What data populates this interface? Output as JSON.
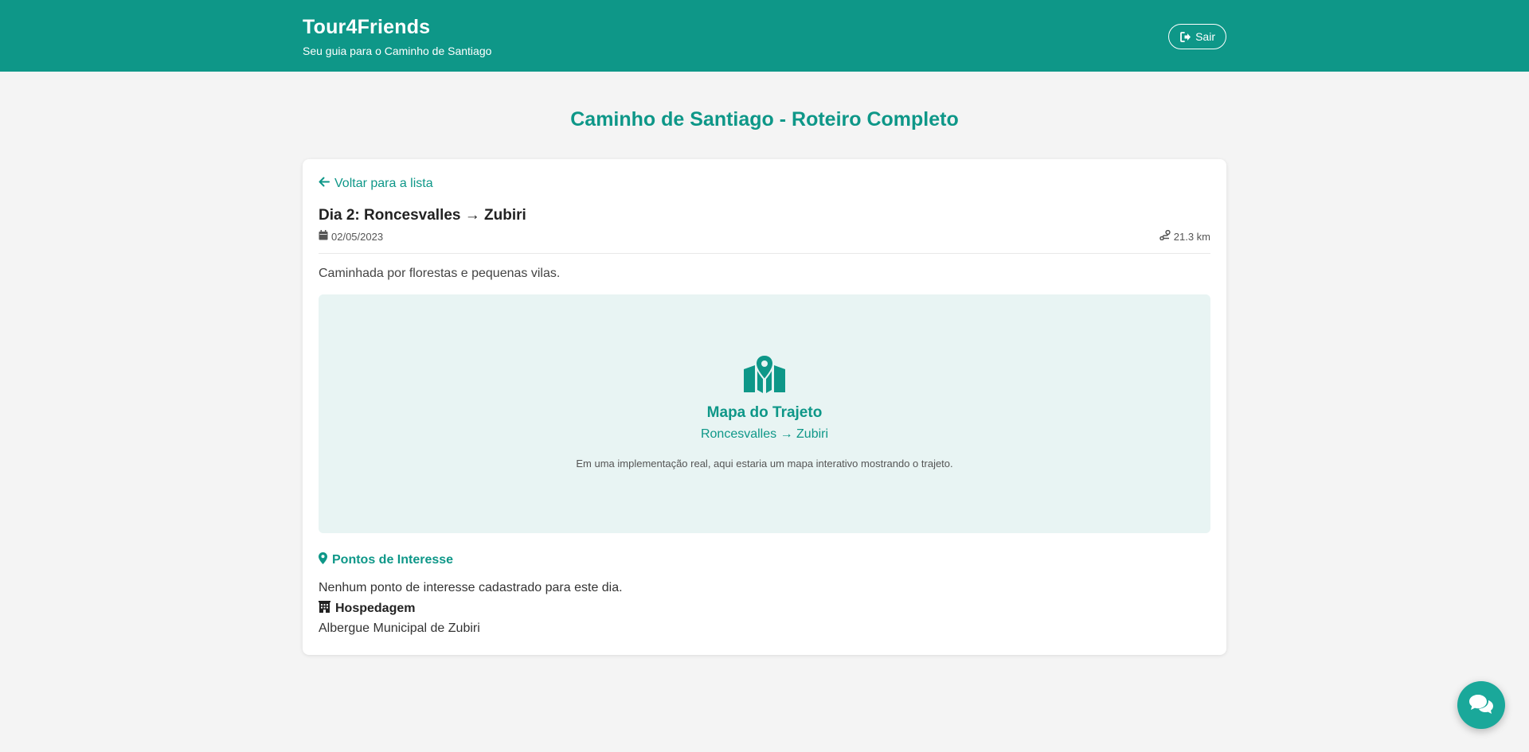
{
  "header": {
    "brand": "Tour4Friends",
    "tagline": "Seu guia para o Caminho de Santiago",
    "logout_label": "Sair"
  },
  "page": {
    "title": "Caminho de Santiago - Roteiro Completo"
  },
  "detail": {
    "back_label": "Voltar para a lista",
    "day_title": "Dia 2: Roncesvalles → Zubiri",
    "date": "02/05/2023",
    "distance": "21.3 km",
    "description": "Caminhada por florestas e pequenas vilas.",
    "map": {
      "title": "Mapa do Trajeto",
      "route": "Roncesvalles → Zubiri",
      "note": "Em uma implementação real, aqui estaria um mapa interativo mostrando o trajeto."
    },
    "poi": {
      "heading": "Pontos de Interesse",
      "empty_text": "Nenhum ponto de interesse cadastrado para este dia."
    },
    "lodging": {
      "heading": "Hospedagem",
      "name": "Albergue Municipal de Zubiri"
    }
  },
  "colors": {
    "primary": "#0e9788",
    "map_bg": "#e8f4f3",
    "chat_fab": "#1aa89a"
  },
  "icons": {
    "logout": "sign-out-icon",
    "back": "arrow-left-icon",
    "date": "calendar-icon",
    "distance": "route-icon",
    "map": "map-location-icon",
    "poi": "map-pin-icon",
    "lodging": "hotel-icon",
    "chat": "chat-bubbles-icon"
  }
}
